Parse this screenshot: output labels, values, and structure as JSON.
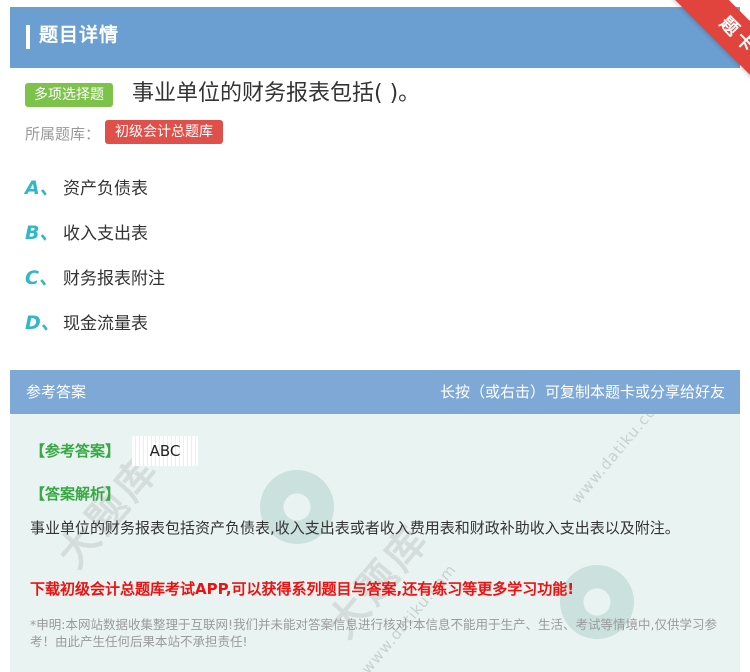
{
  "header": {
    "title": "题目详情",
    "ribbon": "题卡"
  },
  "question": {
    "type_tag": "多项选择题",
    "text": "事业单位的财务报表包括( )。",
    "bank_label": "所属题库：",
    "bank_name": "初级会计总题库"
  },
  "options": [
    {
      "letter": "A、",
      "text": "资产负债表"
    },
    {
      "letter": "B、",
      "text": "收入支出表"
    },
    {
      "letter": "C、",
      "text": "财务报表附注"
    },
    {
      "letter": "D、",
      "text": "现金流量表"
    }
  ],
  "answer": {
    "section_title": "参考答案",
    "share_tip": "长按（或右击）可复制本题卡或分享给好友",
    "answer_label": "【参考答案】",
    "answer_value": "ABC",
    "explanation_label": "【答案解析】",
    "explanation": "事业单位的财务报表包括资产负债表,收入支出表或者收入费用表和财政补助收入支出表以及附注。",
    "promo": "下载初级会计总题库考试APP,可以获得系列题目与答案,还有练习等更多学习功能!",
    "disclaimer": "*申明:本网站数据收集整理于互联网!我们并未能对答案信息进行核对!本信息不能用于生产、生活、考试等情境中,仅供学习参考！由此产生任何后果本站不承担责任!"
  },
  "watermark": {
    "brand": "大题库",
    "site": "www.datiku.com"
  },
  "colors": {
    "header_blue": "#6b9fd1",
    "ribbon_red": "#e0443d",
    "tag_green": "#7dc24a",
    "bank_red": "#e0504a",
    "option_teal": "#2fb8c7",
    "answer_green": "#38a844",
    "promo_red": "#ee1111"
  }
}
